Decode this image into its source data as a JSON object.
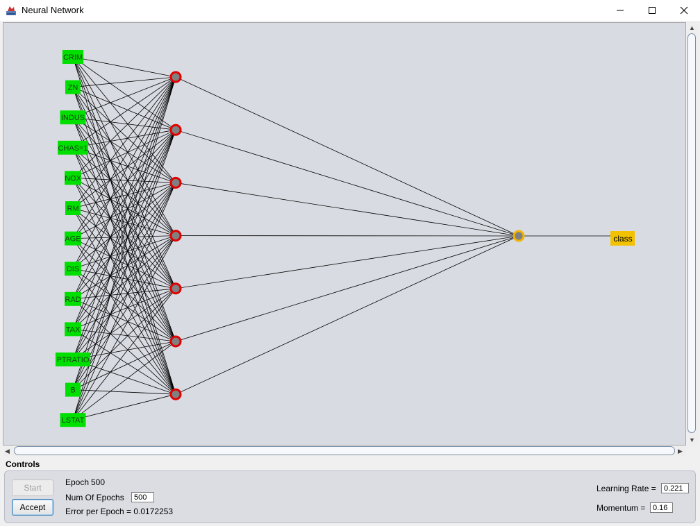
{
  "window": {
    "title": "Neural Network"
  },
  "network": {
    "inputs": [
      "CRIM",
      "ZN",
      "INDUS",
      "CHAS=1",
      "NOX",
      "RM",
      "AGE",
      "DIS",
      "RAD",
      "TAX",
      "PTRATIO",
      "B",
      "LSTAT"
    ],
    "hidden_count": 7,
    "output_label": "class",
    "colors": {
      "input_node": "#00e000",
      "hidden_ring": "#e00000",
      "node_center": "#808080",
      "output_ring": "#f2b400",
      "output_label_bg": "#f2c200",
      "edge": "#000000",
      "canvas_bg": "#d9dbe2"
    }
  },
  "controls": {
    "title": "Controls",
    "start_label": "Start",
    "accept_label": "Accept",
    "epoch_label": "Epoch",
    "epoch_value": "500",
    "num_epochs_label": "Num Of Epochs",
    "num_epochs_value": "500",
    "error_text": "Error per Epoch = 0.0172253",
    "learning_rate_label": "Learning Rate =",
    "learning_rate_value": "0.221",
    "momentum_label": "Momentum =",
    "momentum_value": "0.16"
  }
}
